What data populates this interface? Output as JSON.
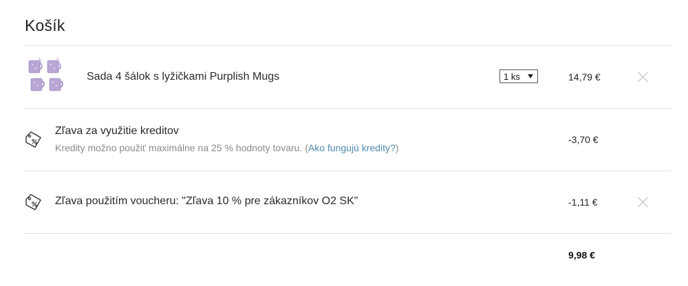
{
  "cart": {
    "title": "Košík",
    "item": {
      "name": "Sada 4 šálok s lyžičkami Purplish Mugs",
      "quantity": "1 ks",
      "price": "14,79 €",
      "image_icon": "purple-mugs-thumbnail"
    },
    "credit_discount": {
      "title": "Zľava za využitie kreditov",
      "note": "Kredity možno použiť maximálne na 25 % hodnoty tovaru. (",
      "link": "Ako fungujú kredity?",
      "note_end": ")",
      "amount": "-3,70 €",
      "icon": "discount-tag-icon"
    },
    "voucher_discount": {
      "title": "Zľava použitím voucheru: \"Zľava 10 % pre zákazníkov O2 SK\"",
      "amount": "-1,11 €",
      "icon": "discount-tag-icon"
    },
    "total": "9,98 €"
  },
  "colors": {
    "link": "#4f8ab0",
    "separator": "#e3e3e3",
    "mug": "#b9a6d6"
  }
}
